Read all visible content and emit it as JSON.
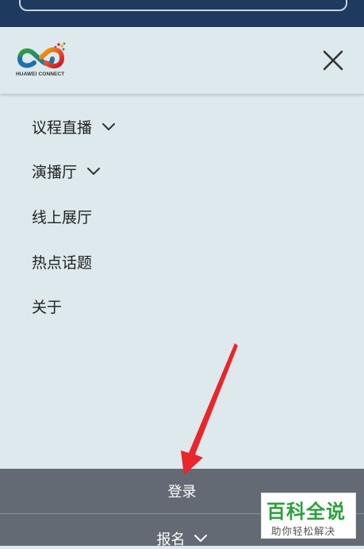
{
  "header": {
    "logo_text": "HUAWEI CONNECT"
  },
  "nav": {
    "items": [
      {
        "label": "议程直播",
        "has_submenu": true
      },
      {
        "label": "演播厅",
        "has_submenu": true
      },
      {
        "label": "线上展厅",
        "has_submenu": false
      },
      {
        "label": "热点话题",
        "has_submenu": false
      },
      {
        "label": "关于",
        "has_submenu": false
      }
    ]
  },
  "footer": {
    "login_label": "登录",
    "signup_label": "报名"
  },
  "watermark": {
    "title": "百科全说",
    "subtitle": "助你轻松解决"
  },
  "colors": {
    "top_bar": "#1f3a5f",
    "menu_bg": "#dde9ec",
    "footer_bg": "#646a73",
    "annotation_arrow": "#e8262c",
    "watermark_green": "#2aa13b"
  }
}
